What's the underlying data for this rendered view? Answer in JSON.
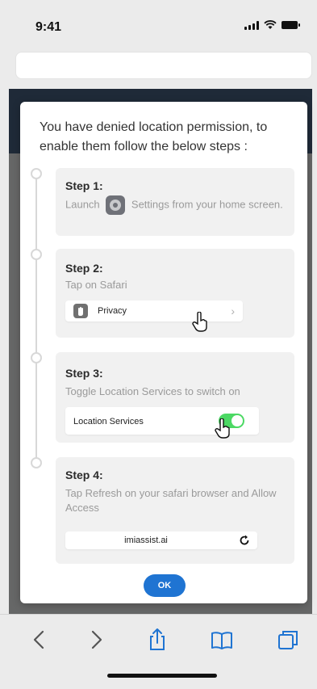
{
  "status_bar": {
    "time": "9:41"
  },
  "modal": {
    "title": "You have denied location permission, to enable them follow the below steps :",
    "steps": [
      {
        "label": "Step 1:",
        "text_before": "Launch",
        "text_after": "Settings from your home screen."
      },
      {
        "label": "Step 2:",
        "text": "Tap on Safari",
        "row_label": "Privacy",
        "row_chevron": "›"
      },
      {
        "label": "Step 3:",
        "text": "Toggle Location Services to switch on",
        "row_label": "Location Services",
        "toggle_on": true
      },
      {
        "label": "Step 4:",
        "text": "Tap Refresh on your safari browser and Allow Access",
        "row_label": "imiassist.ai"
      }
    ],
    "ok_label": "OK"
  },
  "toolbar": {
    "icons": [
      "back-icon",
      "forward-icon",
      "share-icon",
      "bookmarks-icon",
      "tabs-icon"
    ]
  },
  "colors": {
    "accent": "#1f74d2",
    "toggle": "#4cd964",
    "overlay": "#666767",
    "header_dark": "#1f2a38"
  }
}
